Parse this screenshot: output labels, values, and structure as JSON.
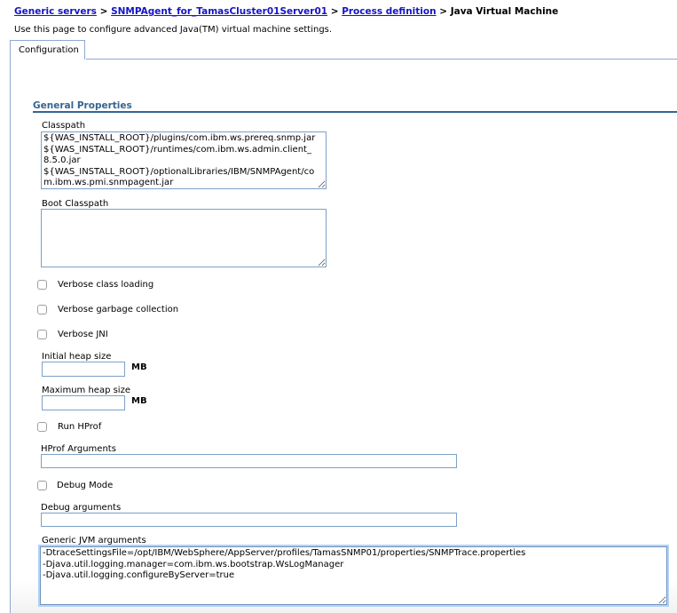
{
  "breadcrumb": {
    "items": [
      {
        "label": "Generic servers",
        "link": true
      },
      {
        "label": "SNMPAgent_for_TamasCluster01Server01",
        "link": true
      },
      {
        "label": "Process definition",
        "link": true
      },
      {
        "label": "Java Virtual Machine",
        "link": false
      }
    ],
    "separator": ">"
  },
  "description": "Use this page to configure advanced Java(TM) virtual machine settings.",
  "tabs": [
    {
      "label": "Configuration",
      "active": true
    }
  ],
  "section": {
    "title": "General Properties"
  },
  "fields": {
    "classpath": {
      "label": "Classpath",
      "value": "${WAS_INSTALL_ROOT}/plugins/com.ibm.ws.prereq.snmp.jar\n${WAS_INSTALL_ROOT}/runtimes/com.ibm.ws.admin.client_\n8.5.0.jar\n${WAS_INSTALL_ROOT}/optionalLibraries/IBM/SNMPAgent/co\nm.ibm.ws.pmi.snmpagent.jar"
    },
    "boot_classpath": {
      "label": "Boot Classpath",
      "value": ""
    },
    "verbose_class_loading": {
      "label": "Verbose class loading",
      "checked": false
    },
    "verbose_gc": {
      "label": "Verbose garbage collection",
      "checked": false
    },
    "verbose_jni": {
      "label": "Verbose JNI",
      "checked": false
    },
    "initial_heap": {
      "label": "Initial heap size",
      "value": "",
      "unit": "MB"
    },
    "max_heap": {
      "label": "Maximum heap size",
      "value": "",
      "unit": "MB"
    },
    "run_hprof": {
      "label": "Run HProf",
      "checked": false
    },
    "hprof_args": {
      "label": "HProf Arguments",
      "value": ""
    },
    "debug_mode": {
      "label": "Debug Mode",
      "checked": false
    },
    "debug_args": {
      "label": "Debug arguments",
      "value": ""
    },
    "generic_jvm_args": {
      "label": "Generic JVM arguments",
      "value": "-DtraceSettingsFile=/opt/IBM/WebSphere/AppServer/profiles/TamasSNMP01/properties/SNMPTrace.properties\n-Djava.util.logging.manager=com.ibm.ws.bootstrap.WsLogManager\n-Djava.util.logging.configureByServer=true"
    }
  }
}
